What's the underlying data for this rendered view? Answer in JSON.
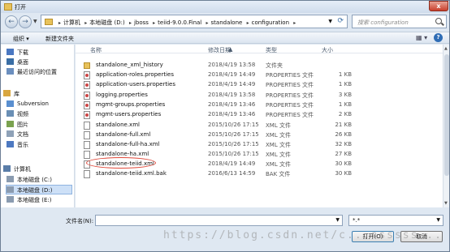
{
  "window": {
    "title": "打开",
    "close": "x"
  },
  "nav": {
    "back": "←",
    "forward": "→"
  },
  "address": {
    "crumbs": [
      "计算机",
      "本地磁盘 (D:)",
      "jboss",
      "teiid-9.0.0.Final",
      "standalone",
      "configuration"
    ]
  },
  "search": {
    "placeholder": "搜索 configuration"
  },
  "toolbar": {
    "organize": "组织 ▾",
    "new_folder": "新建文件夹"
  },
  "sidebar": {
    "items": [
      {
        "label": "下载",
        "icon": "download-folder-icon",
        "color": "#4a78c2"
      },
      {
        "label": "桌面",
        "icon": "desktop-icon",
        "color": "#3a6ea5"
      },
      {
        "label": "最近访问的位置",
        "icon": "recent-places-icon",
        "color": "#6b8fbf"
      },
      {
        "label": "库",
        "icon": "library-icon",
        "color": "#d9a740"
      },
      {
        "label": "Subversion",
        "icon": "subversion-icon",
        "color": "#5a8fd0"
      },
      {
        "label": "视频",
        "icon": "video-icon",
        "color": "#6a8fb5"
      },
      {
        "label": "图片",
        "icon": "pictures-icon",
        "color": "#7aa24f"
      },
      {
        "label": "文档",
        "icon": "documents-icon",
        "color": "#8fa2b8"
      },
      {
        "label": "音乐",
        "icon": "music-icon",
        "color": "#4d79c1"
      },
      {
        "label": "计算机",
        "icon": "computer-icon",
        "color": "#5a7da8"
      },
      {
        "label": "本地磁盘 (C:)",
        "icon": "drive-icon",
        "color": "#8a9bb0"
      },
      {
        "label": "本地磁盘 (D:)",
        "icon": "drive-icon",
        "color": "#8a9bb0"
      },
      {
        "label": "本地磁盘 (E:)",
        "icon": "drive-icon",
        "color": "#8a9bb0"
      }
    ]
  },
  "columns": {
    "name": "名称",
    "date": "修改日期",
    "type": "类型",
    "size": "大小"
  },
  "files": [
    {
      "name": "standalone_xml_history",
      "date": "2018/4/19 13:58",
      "type": "文件夹",
      "size": "",
      "icon": "folder"
    },
    {
      "name": "application-roles.properties",
      "date": "2018/4/19 14:49",
      "type": "PROPERTIES 文件",
      "size": "1 KB",
      "icon": "prop"
    },
    {
      "name": "application-users.properties",
      "date": "2018/4/19 14:49",
      "type": "PROPERTIES 文件",
      "size": "1 KB",
      "icon": "prop"
    },
    {
      "name": "logging.properties",
      "date": "2018/4/19 13:58",
      "type": "PROPERTIES 文件",
      "size": "3 KB",
      "icon": "prop"
    },
    {
      "name": "mgmt-groups.properties",
      "date": "2018/4/19 13:46",
      "type": "PROPERTIES 文件",
      "size": "1 KB",
      "icon": "prop"
    },
    {
      "name": "mgmt-users.properties",
      "date": "2018/4/19 13:46",
      "type": "PROPERTIES 文件",
      "size": "2 KB",
      "icon": "prop"
    },
    {
      "name": "standalone.xml",
      "date": "2015/10/26 17:15",
      "type": "XML 文件",
      "size": "21 KB",
      "icon": "xml"
    },
    {
      "name": "standalone-full.xml",
      "date": "2015/10/26 17:15",
      "type": "XML 文件",
      "size": "26 KB",
      "icon": "xml"
    },
    {
      "name": "standalone-full-ha.xml",
      "date": "2015/10/26 17:15",
      "type": "XML 文件",
      "size": "32 KB",
      "icon": "xml"
    },
    {
      "name": "standalone-ha.xml",
      "date": "2015/10/26 17:15",
      "type": "XML 文件",
      "size": "27 KB",
      "icon": "xml"
    },
    {
      "name": "standalone-teiid.xml",
      "date": "2018/4/19 14:49",
      "type": "XML 文件",
      "size": "30 KB",
      "icon": "xml"
    },
    {
      "name": "standalone-teiid.xml.bak",
      "date": "2016/6/13 14:59",
      "type": "BAK 文件",
      "size": "30 KB",
      "icon": "xml"
    }
  ],
  "bottom": {
    "filename_label": "文件名(N):",
    "filename_value": "",
    "filter": "*.*",
    "open_label": "打开(O)",
    "cancel_label": "取消"
  },
  "watermark": "https://blog.csdn.net/c...ssssss..."
}
